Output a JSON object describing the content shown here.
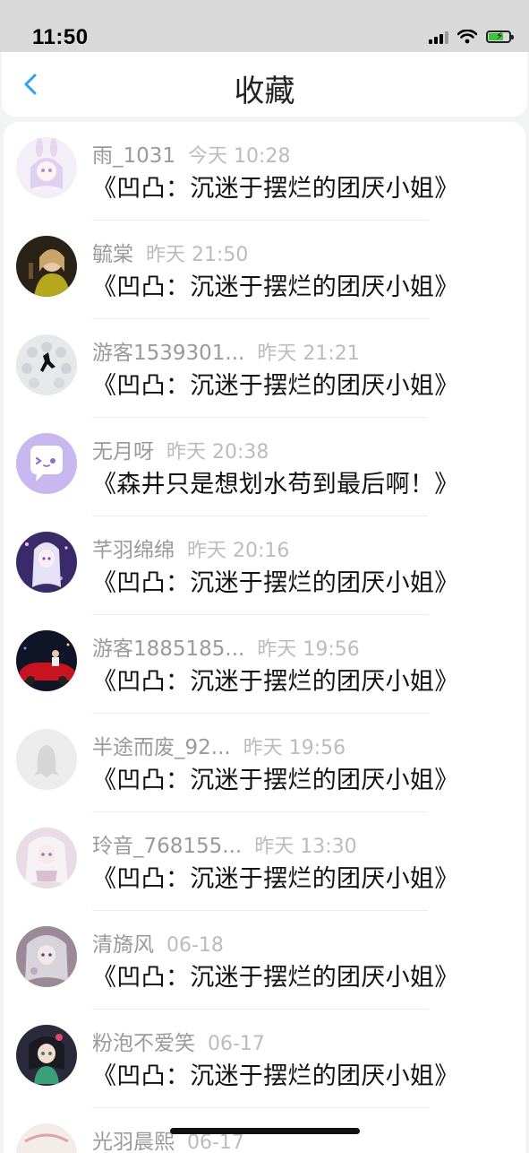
{
  "status_bar": {
    "time": "11:50"
  },
  "header": {
    "title": "收藏"
  },
  "favorites": [
    {
      "name": "雨_1031",
      "time": "今天 10:28",
      "book": "《凹凸：沉迷于摆烂的团厌小姐》",
      "avatar": "avatar-bunny-girl"
    },
    {
      "name": "毓棠",
      "time": "昨天 21:50",
      "book": "《凹凸：沉迷于摆烂的团厌小姐》",
      "avatar": "avatar-photo-girl"
    },
    {
      "name": "游客1539301...",
      "time": "昨天 21:21",
      "book": "《凹凸：沉迷于摆烂的团厌小姐》",
      "avatar": "avatar-runner"
    },
    {
      "name": "无月呀",
      "time": "昨天 20:38",
      "book": "《森井只是想划水苟到最后啊！》",
      "avatar": "avatar-chat-bubble"
    },
    {
      "name": "芊羽绵绵",
      "time": "昨天 20:16",
      "book": "《凹凸：沉迷于摆烂的团厌小姐》",
      "avatar": "avatar-anime-purple"
    },
    {
      "name": "游客1885185...",
      "time": "昨天 19:56",
      "book": "《凹凸：沉迷于摆烂的团厌小姐》",
      "avatar": "avatar-car-night"
    },
    {
      "name": "半途而废_92...",
      "time": "昨天 19:56",
      "book": "《凹凸：沉迷于摆烂的团厌小姐》",
      "avatar": "avatar-default"
    },
    {
      "name": "玲音_768155...",
      "time": "昨天 13:30",
      "book": "《凹凸：沉迷于摆烂的团厌小姐》",
      "avatar": "avatar-anime-white"
    },
    {
      "name": "清旖风",
      "time": "06-18",
      "book": "《凹凸：沉迷于摆烂的团厌小姐》",
      "avatar": "avatar-anime-grey"
    },
    {
      "name": "粉泡不爱笑",
      "time": "06-17",
      "book": "《凹凸：沉迷于摆烂的团厌小姐》",
      "avatar": "avatar-anime-green"
    },
    {
      "name": "光羽晨熙",
      "time": "06-17",
      "book": "",
      "avatar": "avatar-partial"
    }
  ]
}
